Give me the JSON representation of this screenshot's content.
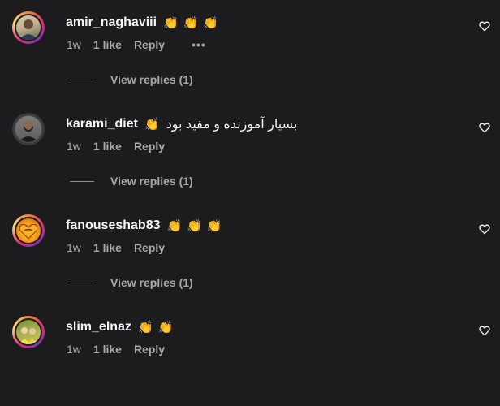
{
  "comments": [
    {
      "username": "amir_naghaviii",
      "text": "",
      "emojis": [
        "👏",
        "👏",
        "👏"
      ],
      "time": "1w",
      "likes": "1 like",
      "reply_label": "Reply",
      "more": "•••",
      "view_replies": "View replies (1)"
    },
    {
      "username": "karami_diet",
      "text": "بسیار آموزنده و مفید بود",
      "emojis": [
        "👏"
      ],
      "time": "1w",
      "likes": "1 like",
      "reply_label": "Reply",
      "view_replies": "View replies (1)"
    },
    {
      "username": "fanouseshab83",
      "text": "",
      "emojis": [
        "👏",
        "👏",
        "👏"
      ],
      "time": "1w",
      "likes": "1 like",
      "reply_label": "Reply",
      "view_replies": "View replies (1)"
    },
    {
      "username": "slim_elnaz",
      "text": "",
      "emojis": [
        "👏",
        "👏"
      ],
      "time": "1w",
      "likes": "1 like",
      "reply_label": "Reply"
    }
  ],
  "colors": {
    "background": "#1c1c1e",
    "text": "#f5f5f5",
    "muted": "#a8a8a8",
    "story_ring": "#dd2a7b"
  },
  "icons": {
    "like": "heart-outline-icon",
    "more": "more-options-icon"
  }
}
